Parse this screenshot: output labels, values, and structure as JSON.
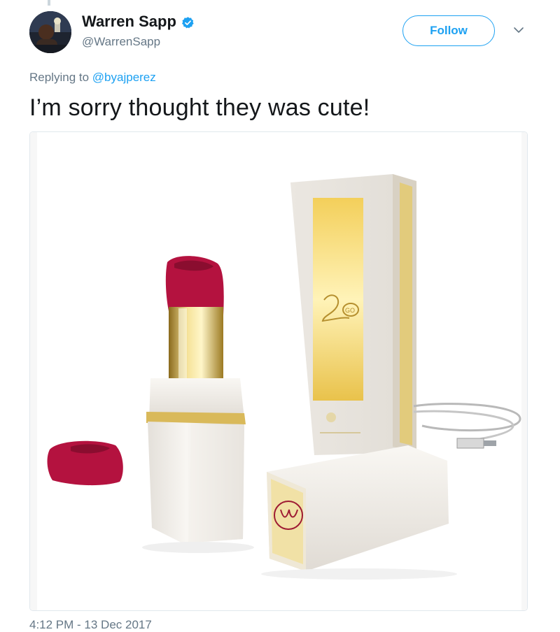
{
  "tweet": {
    "author": {
      "display_name": "Warren Sapp",
      "handle": "@WarrenSapp",
      "verified": true
    },
    "follow_label": "Follow",
    "replying_to_prefix": "Replying to",
    "replying_to_handle": "@byajperez",
    "text": "I’m sorry thought they was cute!",
    "timestamp": "4:12 PM - 13 Dec 2017"
  },
  "colors": {
    "accent": "#1da1f2",
    "secondary_text": "#657786",
    "primary_text": "#14171a",
    "border": "#e1e8ed"
  },
  "icons": {
    "verified": "verified-badge-icon",
    "more": "chevron-down-icon"
  }
}
